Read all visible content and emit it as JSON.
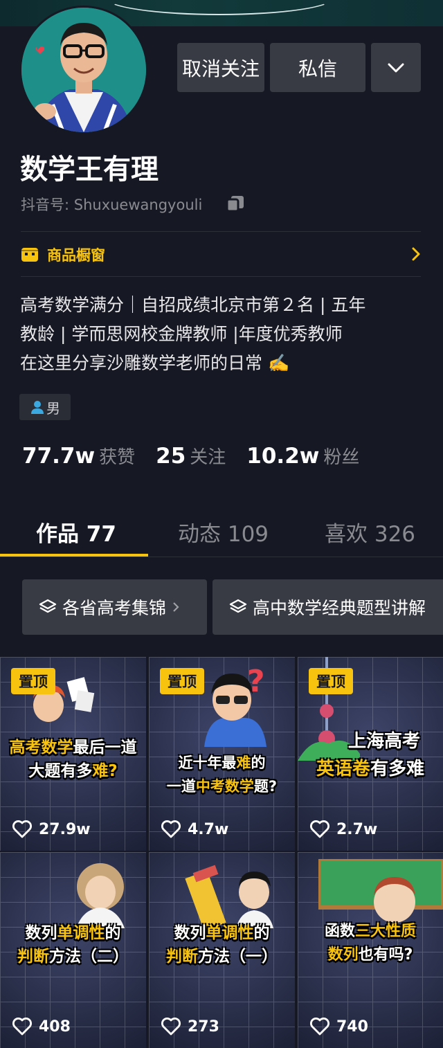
{
  "header": {
    "unfollow_label": "取消关注",
    "message_label": "私信"
  },
  "profile": {
    "name": "数学王有理",
    "douyin_id_label": "抖音号: Shuxuewangyouli",
    "gender": "男"
  },
  "shop": {
    "label": "商品橱窗"
  },
  "bio": {
    "lines": [
      "高考数学满分｜自招成绩北京市第２名 | 五年",
      "教龄 | 学而思网校金牌教师 |年度优秀教师",
      "在这里分享沙雕数学老师的日常 ✍️"
    ]
  },
  "stats": {
    "likes_value": "77.7w",
    "likes_label": "获赞",
    "following_value": "25",
    "following_label": "关注",
    "fans_value": "10.2w",
    "fans_label": "粉丝"
  },
  "tabs": [
    {
      "label": "作品 77",
      "active": true
    },
    {
      "label": "动态 109"
    },
    {
      "label": "喜欢 326"
    }
  ],
  "collections": [
    {
      "label": "各省高考集锦"
    },
    {
      "label": "高中数学经典题型讲解"
    }
  ],
  "videos": [
    {
      "pinned": "置顶",
      "title_1": "高考数学",
      "title_1b": "最后一道",
      "title_2a": "大题有多",
      "title_2b": "难?",
      "likes": "27.9w"
    },
    {
      "pinned": "置顶",
      "title_1": "近十年最",
      "title_1b": "难",
      "title_1c": "的",
      "title_2a": "一道",
      "title_2b": "中考数学",
      "title_2c": "题?",
      "likes": "4.7w"
    },
    {
      "pinned": "置顶",
      "title_1": "上海高考",
      "title_2a": "英语卷",
      "title_2b": "有多难",
      "likes": "2.7w"
    },
    {
      "title_1": "数列",
      "title_1b": "单调性",
      "title_1c": "的",
      "title_2a": "判断",
      "title_2b": "方法（二）",
      "likes": "408"
    },
    {
      "title_1": "数列",
      "title_1b": "单调性",
      "title_1c": "的",
      "title_2a": "判断",
      "title_2b": "方法（一）",
      "likes": "273"
    },
    {
      "title_1": "函数",
      "title_1b": "三大性质",
      "title_2a": "数列",
      "title_2b": "也有吗?",
      "likes": "740"
    }
  ],
  "colors": {
    "accent": "#f8c30f",
    "background": "#161823",
    "button": "#393b44"
  }
}
